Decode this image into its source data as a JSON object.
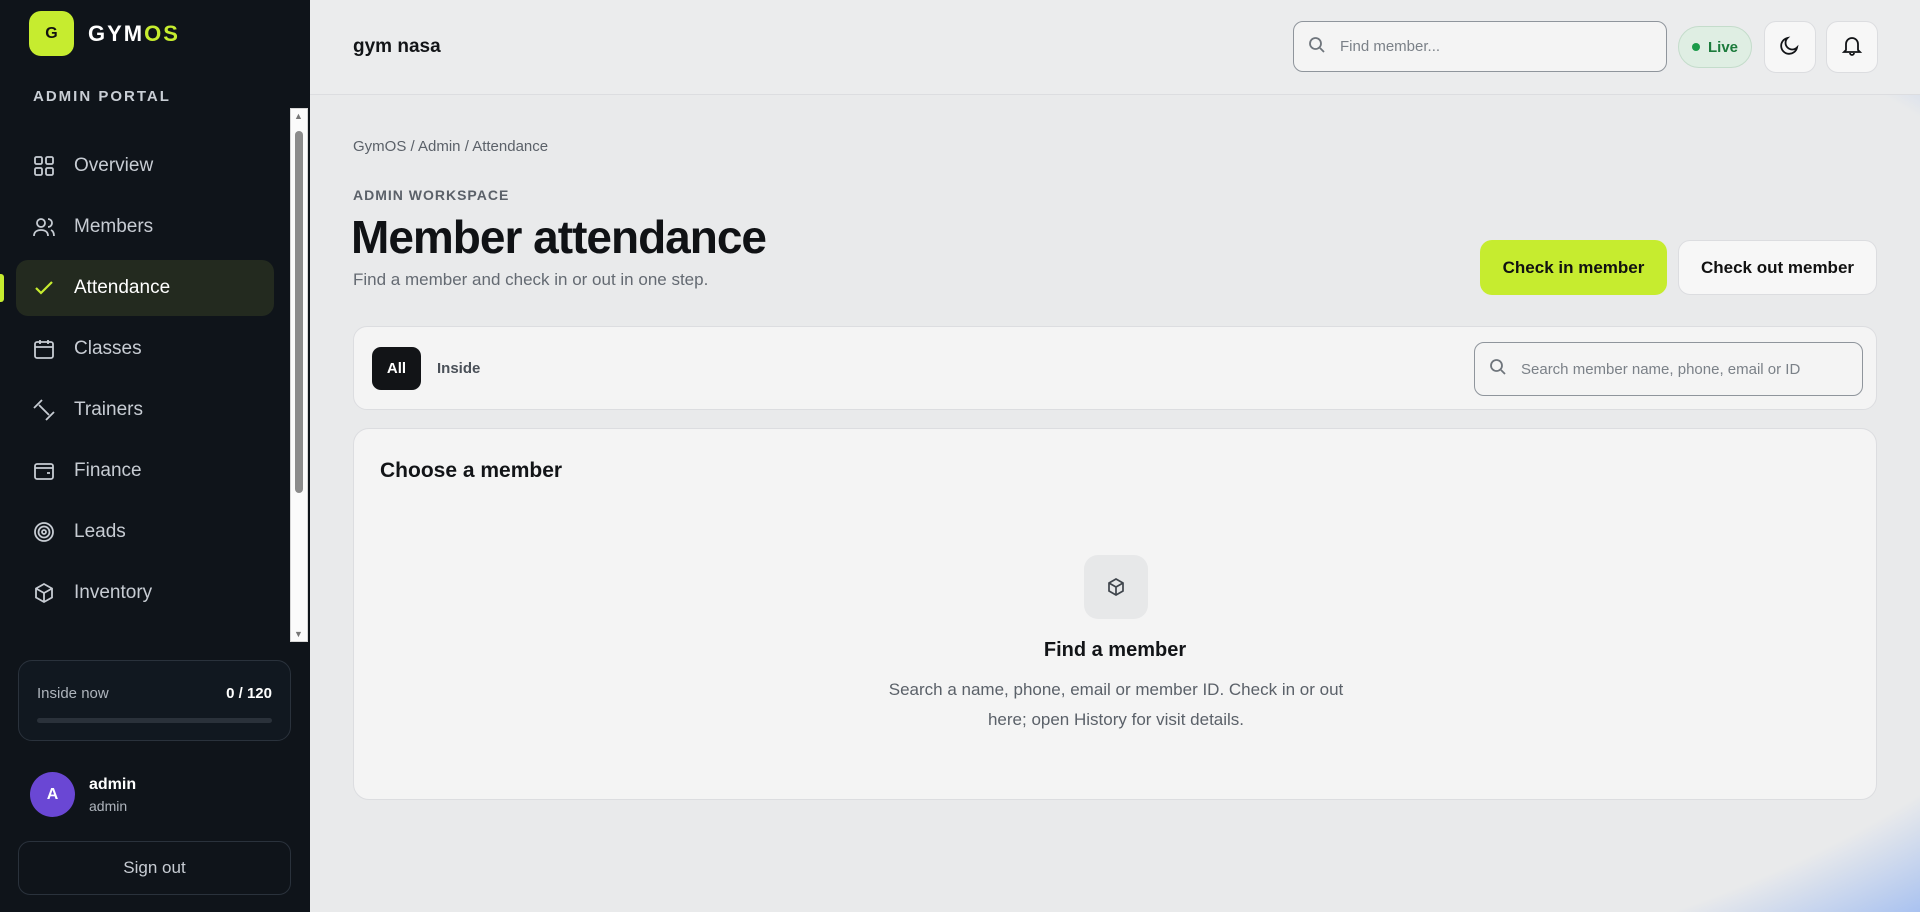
{
  "brand": {
    "logo_letter": "G",
    "name_prefix": "GYM",
    "name_suffix": "OS",
    "accent": "#c6ec2f"
  },
  "sidebar": {
    "section_label": "ADMIN PORTAL",
    "items": [
      {
        "label": "Overview",
        "icon": "grid-icon"
      },
      {
        "label": "Members",
        "icon": "users-icon"
      },
      {
        "label": "Attendance",
        "icon": "check-icon",
        "active": true
      },
      {
        "label": "Classes",
        "icon": "calendar-icon"
      },
      {
        "label": "Trainers",
        "icon": "dumbbell-icon"
      },
      {
        "label": "Finance",
        "icon": "wallet-icon"
      },
      {
        "label": "Leads",
        "icon": "target-icon"
      },
      {
        "label": "Inventory",
        "icon": "box-icon"
      }
    ],
    "inside_now": {
      "label": "Inside now",
      "value": "0 / 120",
      "progress": 0
    },
    "user": {
      "initial": "A",
      "name": "admin",
      "role": "admin"
    },
    "sign_out": "Sign out"
  },
  "topbar": {
    "gym_name": "gym nasa",
    "search_placeholder": "Find member...",
    "live_label": "Live"
  },
  "main": {
    "breadcrumb": "GymOS / Admin / Attendance",
    "eyebrow": "ADMIN WORKSPACE",
    "title": "Member attendance",
    "subtitle": "Find a member and check in or out in one step.",
    "primary_action": "Check in member",
    "secondary_action": "Check out member",
    "tabs": [
      {
        "label": "All",
        "active": true
      },
      {
        "label": "Inside"
      }
    ],
    "search_placeholder": "Search member name, phone, email or ID",
    "card": {
      "title": "Choose a member",
      "empty_title": "Find a member",
      "empty_desc": "Search a name, phone, email or member ID. Check in or out here; open History for visit details."
    }
  }
}
